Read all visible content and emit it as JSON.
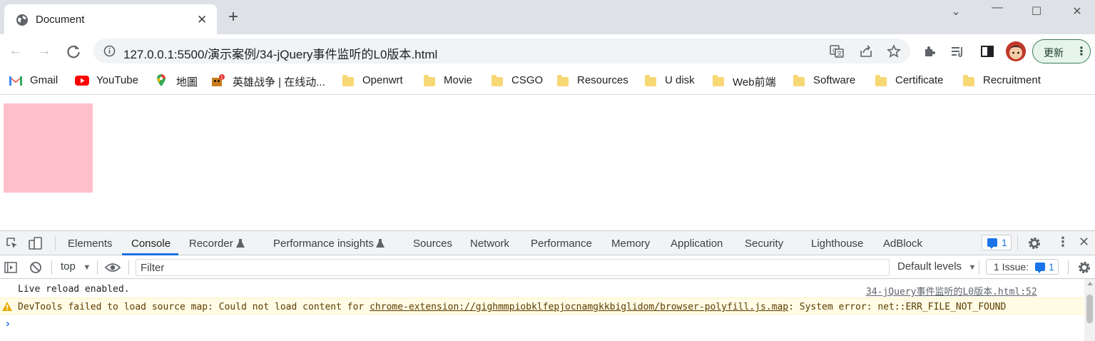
{
  "tab": {
    "title": "Document",
    "close": "✕",
    "new_tab": "+"
  },
  "window": {
    "chevron": "⌄",
    "minimize": "—",
    "maximize": "☐",
    "close": "✕"
  },
  "toolbar": {
    "url": "127.0.0.1:5500/演示案例/34-jQuery事件监听的L0版本.html",
    "update_label": "更新"
  },
  "bookmarks": [
    {
      "label": "Gmail",
      "icon": "gmail-icon"
    },
    {
      "label": "YouTube",
      "icon": "youtube-icon"
    },
    {
      "label": "地圖",
      "icon": "maps-icon"
    },
    {
      "label": "英雄战争 | 在线动...",
      "icon": "game-icon"
    },
    {
      "label": "Openwrt",
      "icon": "folder-icon"
    },
    {
      "label": "Movie",
      "icon": "folder-icon"
    },
    {
      "label": "CSGO",
      "icon": "folder-icon"
    },
    {
      "label": "Resources",
      "icon": "folder-icon"
    },
    {
      "label": "U disk",
      "icon": "folder-icon"
    },
    {
      "label": "Web前端",
      "icon": "folder-icon"
    },
    {
      "label": "Software",
      "icon": "folder-icon"
    },
    {
      "label": "Certificate",
      "icon": "folder-icon"
    },
    {
      "label": "Recruitment",
      "icon": "folder-icon"
    }
  ],
  "page": {
    "box_color": "#ffc0cb"
  },
  "devtools": {
    "tabs": [
      "Elements",
      "Console",
      "Recorder",
      "Performance insights",
      "Sources",
      "Network",
      "Performance",
      "Memory",
      "Application",
      "Security",
      "Lighthouse",
      "AdBlock"
    ],
    "active_tab": "Console",
    "message_count": "1",
    "context": "top",
    "filter_placeholder": "Filter",
    "levels": "Default levels",
    "issues_label": "1 Issue:",
    "issues_count": "1",
    "console": {
      "log_text": "Live reload enabled.",
      "log_source": "34-jQuery事件监听的L0版本.html:52",
      "warn_prefix": "DevTools failed to load source map: Could not load content for ",
      "warn_link": "chrome-extension://gighmmpiobklfepjocnamgkkbiglidom/browser-polyfill.js.map",
      "warn_suffix": ": System error: net::ERR_FILE_NOT_FOUND",
      "prompt": "›"
    }
  },
  "colors": {
    "accent": "#1a73e8",
    "warning_bg": "#fffbe5",
    "tabstrip": "#dee1e6",
    "update_green": "#e6f4ea"
  }
}
